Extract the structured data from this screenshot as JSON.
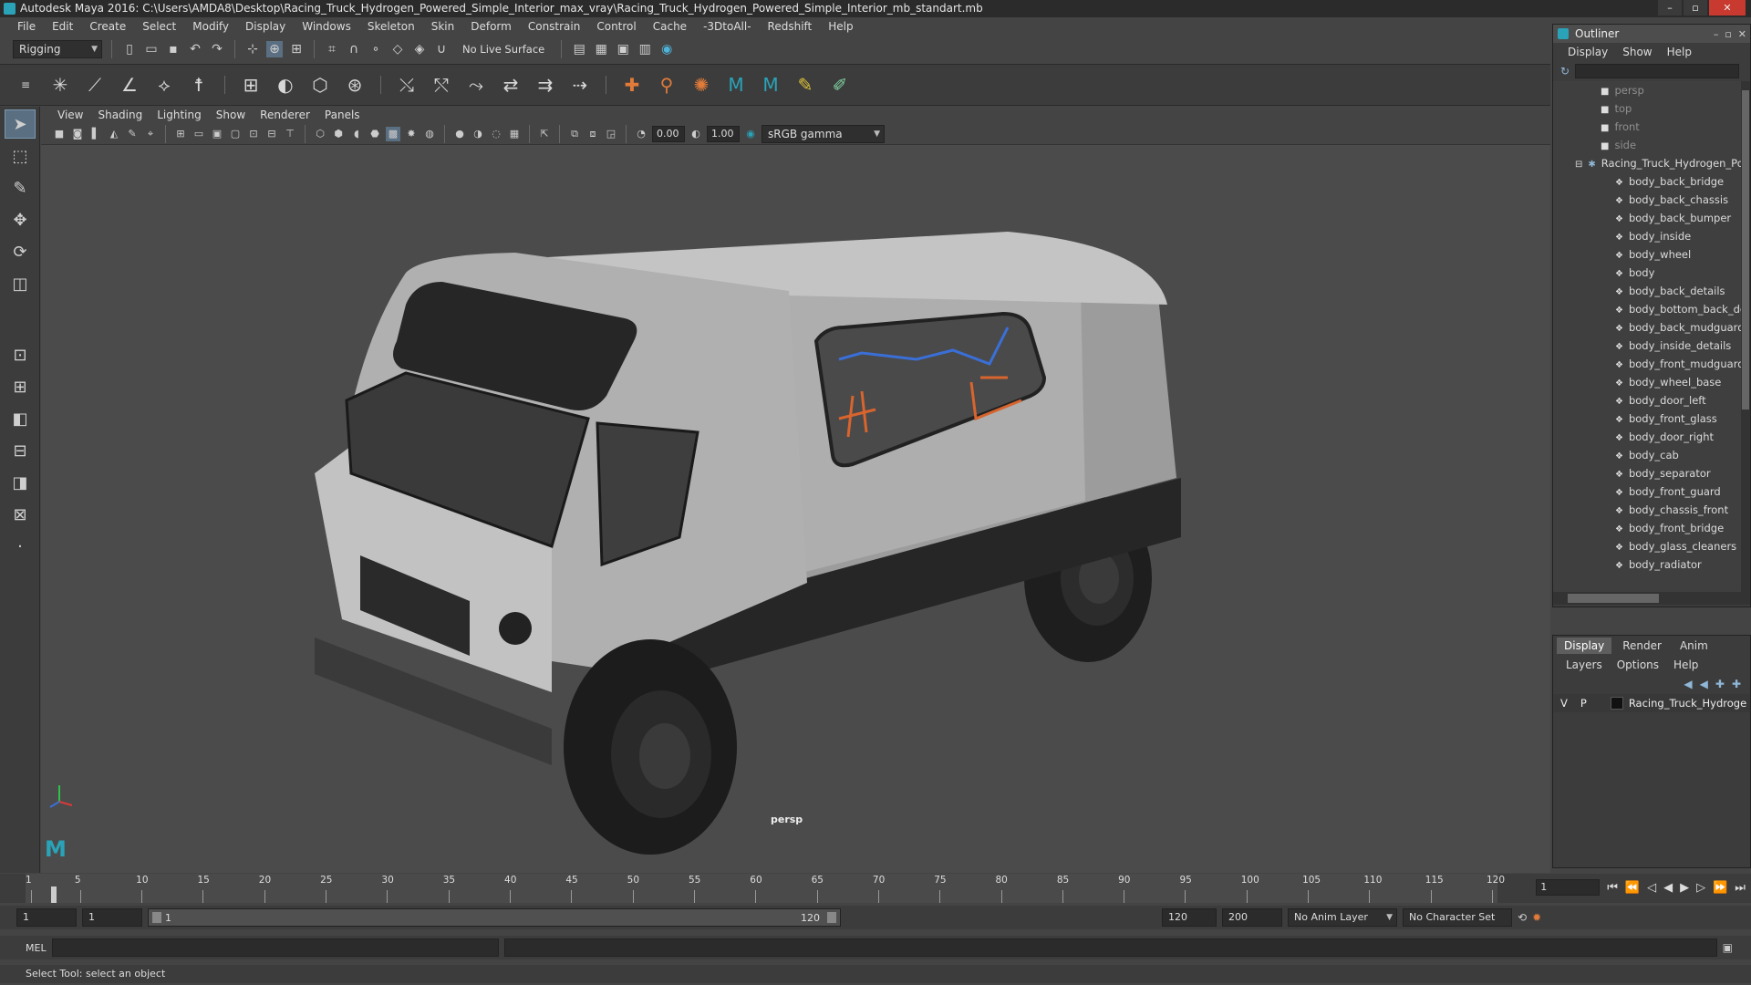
{
  "window": {
    "title": "Autodesk Maya 2016: C:\\Users\\AMDA8\\Desktop\\Racing_Truck_Hydrogen_Powered_Simple_Interior_max_vray\\Racing_Truck_Hydrogen_Powered_Simple_Interior_mb_standart.mb"
  },
  "menubar": [
    "File",
    "Edit",
    "Create",
    "Select",
    "Modify",
    "Display",
    "Windows",
    "Skeleton",
    "Skin",
    "Deform",
    "Constrain",
    "Control",
    "Cache",
    "-3DtoAll-",
    "Redshift",
    "Help"
  ],
  "statusline": {
    "menuset": "Rigging",
    "live_surface": "No Live Surface"
  },
  "viewport": {
    "menu": [
      "View",
      "Shading",
      "Lighting",
      "Show",
      "Renderer",
      "Panels"
    ],
    "exposure": "0.00",
    "gamma": "1.00",
    "color_space": "sRGB gamma",
    "camera_label": "persp"
  },
  "outliner": {
    "title": "Outliner",
    "menu": [
      "Display",
      "Show",
      "Help"
    ],
    "cameras": [
      "persp",
      "top",
      "front",
      "side"
    ],
    "group": "Racing_Truck_Hydrogen_Po",
    "items": [
      "body_back_bridge",
      "body_back_chassis",
      "body_back_bumper",
      "body_inside",
      "body_wheel",
      "body",
      "body_back_details",
      "body_bottom_back_de",
      "body_back_mudguard",
      "body_inside_details",
      "body_front_mudguard",
      "body_wheel_base",
      "body_door_left",
      "body_front_glass",
      "body_door_right",
      "body_cab",
      "body_separator",
      "body_front_guard",
      "body_chassis_front",
      "body_front_bridge",
      "body_glass_cleaners",
      "body_radiator"
    ]
  },
  "layers": {
    "tabs": [
      "Display",
      "Render",
      "Anim"
    ],
    "active_tab": "Display",
    "menu": [
      "Layers",
      "Options",
      "Help"
    ],
    "row": {
      "v": "V",
      "p": "P",
      "name": "Racing_Truck_Hydroge"
    }
  },
  "timeline": {
    "ticks": [
      "1",
      "5",
      "10",
      "15",
      "20",
      "25",
      "30",
      "35",
      "40",
      "45",
      "50",
      "55",
      "60",
      "65",
      "70",
      "75",
      "80",
      "85",
      "90",
      "95",
      "100",
      "105",
      "110",
      "115",
      "120"
    ],
    "current_frame": "1"
  },
  "range": {
    "start": "1",
    "playback_start": "1",
    "slider_start": "1",
    "slider_end": "120",
    "playback_end": "120",
    "end": "200",
    "anim_layer": "No Anim Layer",
    "character_set": "No Character Set"
  },
  "mel": {
    "label": "MEL"
  },
  "helpline": {
    "text": "Select Tool: select an object"
  },
  "colors": {
    "accent": "#2aa3b8",
    "bg": "#444444",
    "viewport": "#4b4b4b"
  }
}
